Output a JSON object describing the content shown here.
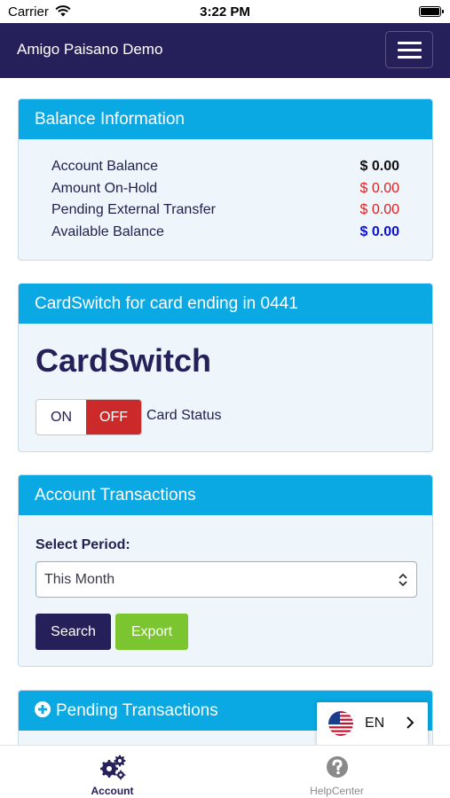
{
  "status_bar": {
    "carrier": "Carrier",
    "time": "3:22 PM"
  },
  "navbar": {
    "title": "Amigo Paisano Demo",
    "menu_icon": "hamburger-icon"
  },
  "balance": {
    "header": "Balance Information",
    "rows": [
      {
        "label": "Account Balance",
        "value": "$ 0.00"
      },
      {
        "label": "Amount On-Hold",
        "value": "$ 0.00"
      },
      {
        "label": "Pending External Transfer",
        "value": "$ 0.00"
      },
      {
        "label": "Available Balance",
        "value": "$ 0.00"
      }
    ]
  },
  "cardswitch": {
    "header": "CardSwitch for card ending in 0441",
    "title": "CardSwitch",
    "on_label": "ON",
    "off_label": "OFF",
    "selected": "OFF",
    "status_label": "Card Status"
  },
  "transactions": {
    "header": "Account Transactions",
    "select_label": "Select Period:",
    "selected_period": "This Month",
    "search_label": "Search",
    "export_label": "Export"
  },
  "pending": {
    "header": "Pending Transactions",
    "icon": "plus-circle-icon"
  },
  "language": {
    "code": "EN",
    "flag": "us-flag-icon"
  },
  "tabs": [
    {
      "label": "Account",
      "icon": "gears-icon",
      "active": true
    },
    {
      "label": "HelpCenter",
      "icon": "question-circle-icon",
      "active": false
    }
  ],
  "colors": {
    "navbar": "#26205a",
    "card_header": "#0ba9e3",
    "negative": "#e02020",
    "available": "#1010d0",
    "off_active": "#cc2a2a",
    "export": "#7bc531"
  }
}
